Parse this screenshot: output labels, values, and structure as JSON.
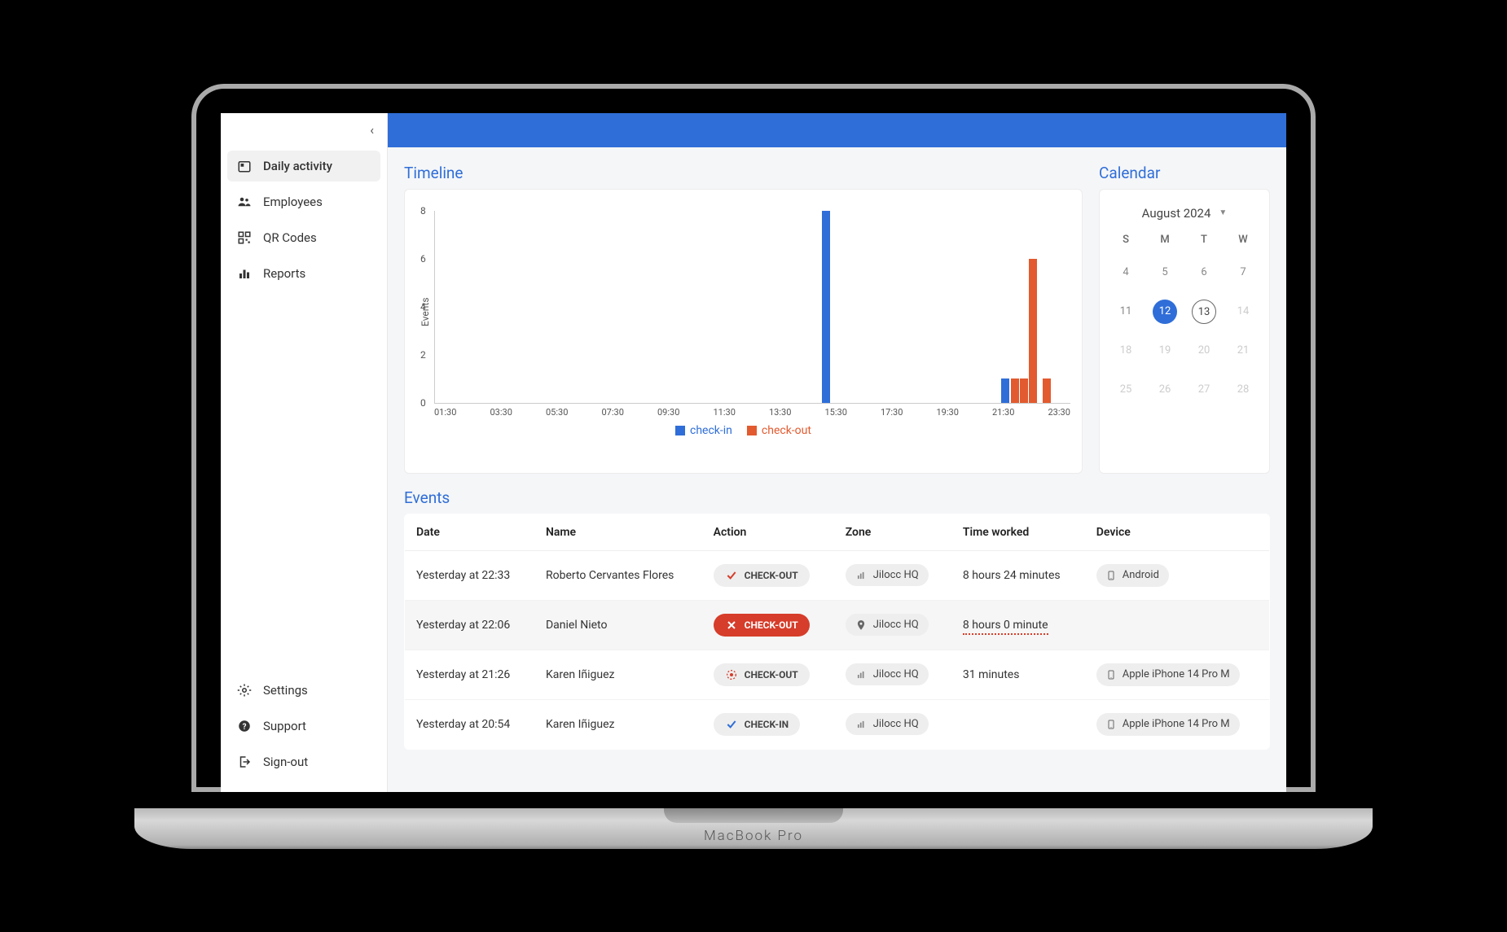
{
  "sidebar": {
    "items": [
      {
        "label": "Daily activity"
      },
      {
        "label": "Employees"
      },
      {
        "label": "QR Codes"
      },
      {
        "label": "Reports"
      }
    ],
    "footer": [
      {
        "label": "Settings"
      },
      {
        "label": "Support"
      },
      {
        "label": "Sign-out"
      }
    ]
  },
  "timeline": {
    "title": "Timeline",
    "ylabel": "Events",
    "legend": {
      "checkin": "check-in",
      "checkout": "check-out"
    }
  },
  "calendar": {
    "title": "Calendar",
    "month_label": "August 2024",
    "weekdays": [
      "S",
      "M",
      "T",
      "W"
    ],
    "rows": [
      [
        {
          "n": "4"
        },
        {
          "n": "5"
        },
        {
          "n": "6"
        },
        {
          "n": "7"
        }
      ],
      [
        {
          "n": "11"
        },
        {
          "n": "12",
          "sel": true
        },
        {
          "n": "13",
          "today": true
        },
        {
          "n": "14",
          "muted": true
        }
      ],
      [
        {
          "n": "18",
          "muted": true
        },
        {
          "n": "19",
          "muted": true
        },
        {
          "n": "20",
          "muted": true
        },
        {
          "n": "21",
          "muted": true
        }
      ],
      [
        {
          "n": "25",
          "muted": true
        },
        {
          "n": "26",
          "muted": true
        },
        {
          "n": "27",
          "muted": true
        },
        {
          "n": "28",
          "muted": true
        }
      ]
    ]
  },
  "events": {
    "title": "Events",
    "columns": [
      "Date",
      "Name",
      "Action",
      "Zone",
      "Time worked",
      "Device"
    ],
    "rows": [
      {
        "date": "Yesterday at 22:33",
        "name": "Roberto Cervantes Flores",
        "action": "CHECK-OUT",
        "action_style": "gray-check",
        "zone": "Jilocc HQ",
        "zone_icon": "bars",
        "time": "8 hours 24 minutes",
        "time_style": "",
        "device": "Android"
      },
      {
        "date": "Yesterday at 22:06",
        "name": "Daniel Nieto",
        "action": "CHECK-OUT",
        "action_style": "red-x",
        "zone": "Jilocc HQ",
        "zone_icon": "pin",
        "time": "8 hours 0 minute",
        "time_style": "dotted",
        "device": ""
      },
      {
        "date": "Yesterday at 21:26",
        "name": "Karen Iñiguez",
        "action": "CHECK-OUT",
        "action_style": "gray-target",
        "zone": "Jilocc HQ",
        "zone_icon": "bars",
        "time": "31 minutes",
        "time_style": "",
        "device": "Apple iPhone 14 Pro M"
      },
      {
        "date": "Yesterday at 20:54",
        "name": "Karen Iñiguez",
        "action": "CHECK-IN",
        "action_style": "gray-bluecheck",
        "zone": "Jilocc HQ",
        "zone_icon": "bars",
        "time": "",
        "time_style": "",
        "device": "Apple iPhone 14 Pro M"
      }
    ]
  },
  "laptop_label": "MacBook Pro",
  "chart_data": {
    "type": "bar",
    "title": "Timeline",
    "ylabel": "Events",
    "ylim": [
      0,
      8
    ],
    "yticks": [
      0,
      2,
      4,
      6,
      8
    ],
    "xlabels": [
      "01:30",
      "03:30",
      "05:30",
      "07:30",
      "09:30",
      "11:30",
      "13:30",
      "15:30",
      "17:30",
      "19:30",
      "21:30",
      "23:30"
    ],
    "series": [
      {
        "name": "check-in",
        "color": "#2f6ed8",
        "bars": [
          {
            "x": "14:30",
            "value": 8
          },
          {
            "x": "21:00",
            "value": 1
          }
        ]
      },
      {
        "name": "check-out",
        "color": "#e25a2f",
        "bars": [
          {
            "x": "21:20",
            "value": 1
          },
          {
            "x": "21:40",
            "value": 1
          },
          {
            "x": "22:00",
            "value": 6
          },
          {
            "x": "22:30",
            "value": 1
          }
        ]
      }
    ]
  }
}
